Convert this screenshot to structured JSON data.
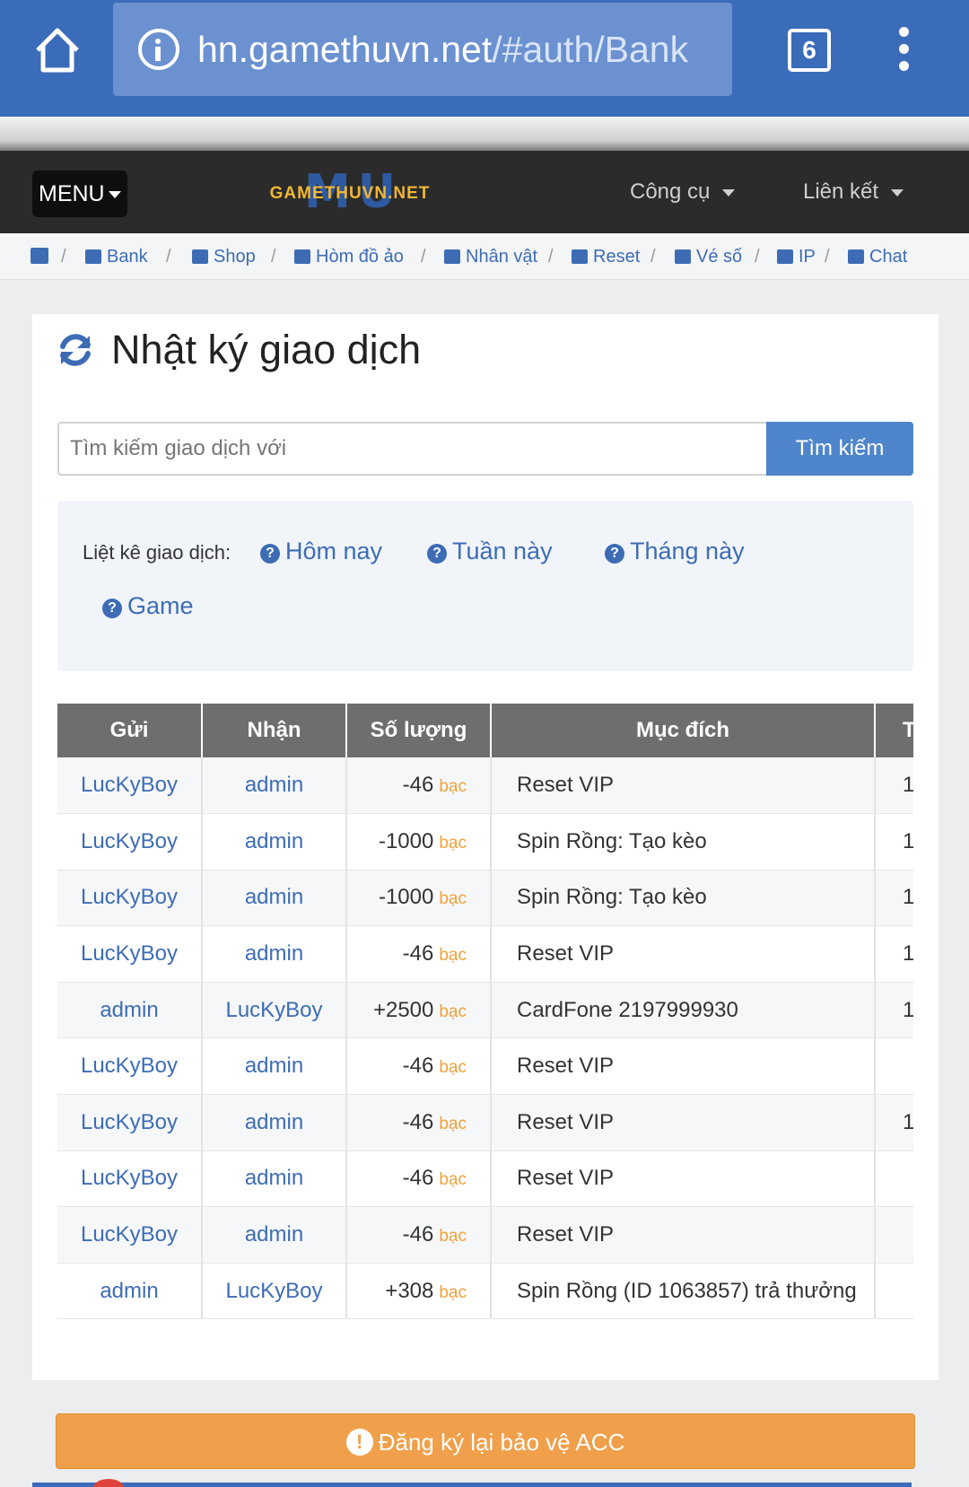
{
  "browser": {
    "url_host": "hn.gamethuvn.net",
    "url_path": "/#auth/Bank",
    "tab_count": "6"
  },
  "navbar": {
    "menu_label": "MENU",
    "logo_mark": "MU",
    "logo_text": "GAMETHUVN.NET",
    "links": [
      "Công cụ",
      "Liên kết"
    ]
  },
  "breadcrumb": {
    "items": [
      "Bank",
      "Shop",
      "Hòm đồ ảo",
      "Nhân vật",
      "Reset",
      "Vé số",
      "IP",
      "Chat"
    ],
    "separator": "/"
  },
  "page": {
    "title": "Nhật ký giao dịch",
    "search_placeholder": "Tìm kiếm giao dịch với",
    "search_button": "Tìm kiếm",
    "filter_label": "Liệt kê giao dịch:",
    "filters": [
      "Hôm nay",
      "Tuần này",
      "Tháng này",
      "Game"
    ]
  },
  "table": {
    "headers": [
      "Gửi",
      "Nhận",
      "Số lượng",
      "Mục đích",
      "T"
    ],
    "unit": "bạc",
    "rows": [
      {
        "from": "LucKyBoy",
        "to": "admin",
        "amount": "-46",
        "purpose": "Reset VIP",
        "time": "1"
      },
      {
        "from": "LucKyBoy",
        "to": "admin",
        "amount": "-1000",
        "purpose": "Spin Rồng: Tạo kèo",
        "time": "1"
      },
      {
        "from": "LucKyBoy",
        "to": "admin",
        "amount": "-1000",
        "purpose": "Spin Rồng: Tạo kèo",
        "time": "1"
      },
      {
        "from": "LucKyBoy",
        "to": "admin",
        "amount": "-46",
        "purpose": "Reset VIP",
        "time": "1"
      },
      {
        "from": "admin",
        "to": "LucKyBoy",
        "amount": "+2500",
        "purpose": "CardFone 2197999930",
        "time": "1"
      },
      {
        "from": "LucKyBoy",
        "to": "admin",
        "amount": "-46",
        "purpose": "Reset VIP",
        "time": ""
      },
      {
        "from": "LucKyBoy",
        "to": "admin",
        "amount": "-46",
        "purpose": "Reset VIP",
        "time": "1"
      },
      {
        "from": "LucKyBoy",
        "to": "admin",
        "amount": "-46",
        "purpose": "Reset VIP",
        "time": ""
      },
      {
        "from": "LucKyBoy",
        "to": "admin",
        "amount": "-46",
        "purpose": "Reset VIP",
        "time": ""
      },
      {
        "from": "admin",
        "to": "LucKyBoy",
        "amount": "+308",
        "purpose": "Spin Rồng (ID 1063857) trả thưởng",
        "time": ""
      }
    ]
  },
  "footer": {
    "warn_button": "Đăng ký lại bảo vệ ACC"
  },
  "colors": {
    "browser_blue": "#3a6cba",
    "link_blue": "#3d6cb5",
    "accent_orange": "#f0a04b",
    "header_gray": "#6e6e6e"
  }
}
